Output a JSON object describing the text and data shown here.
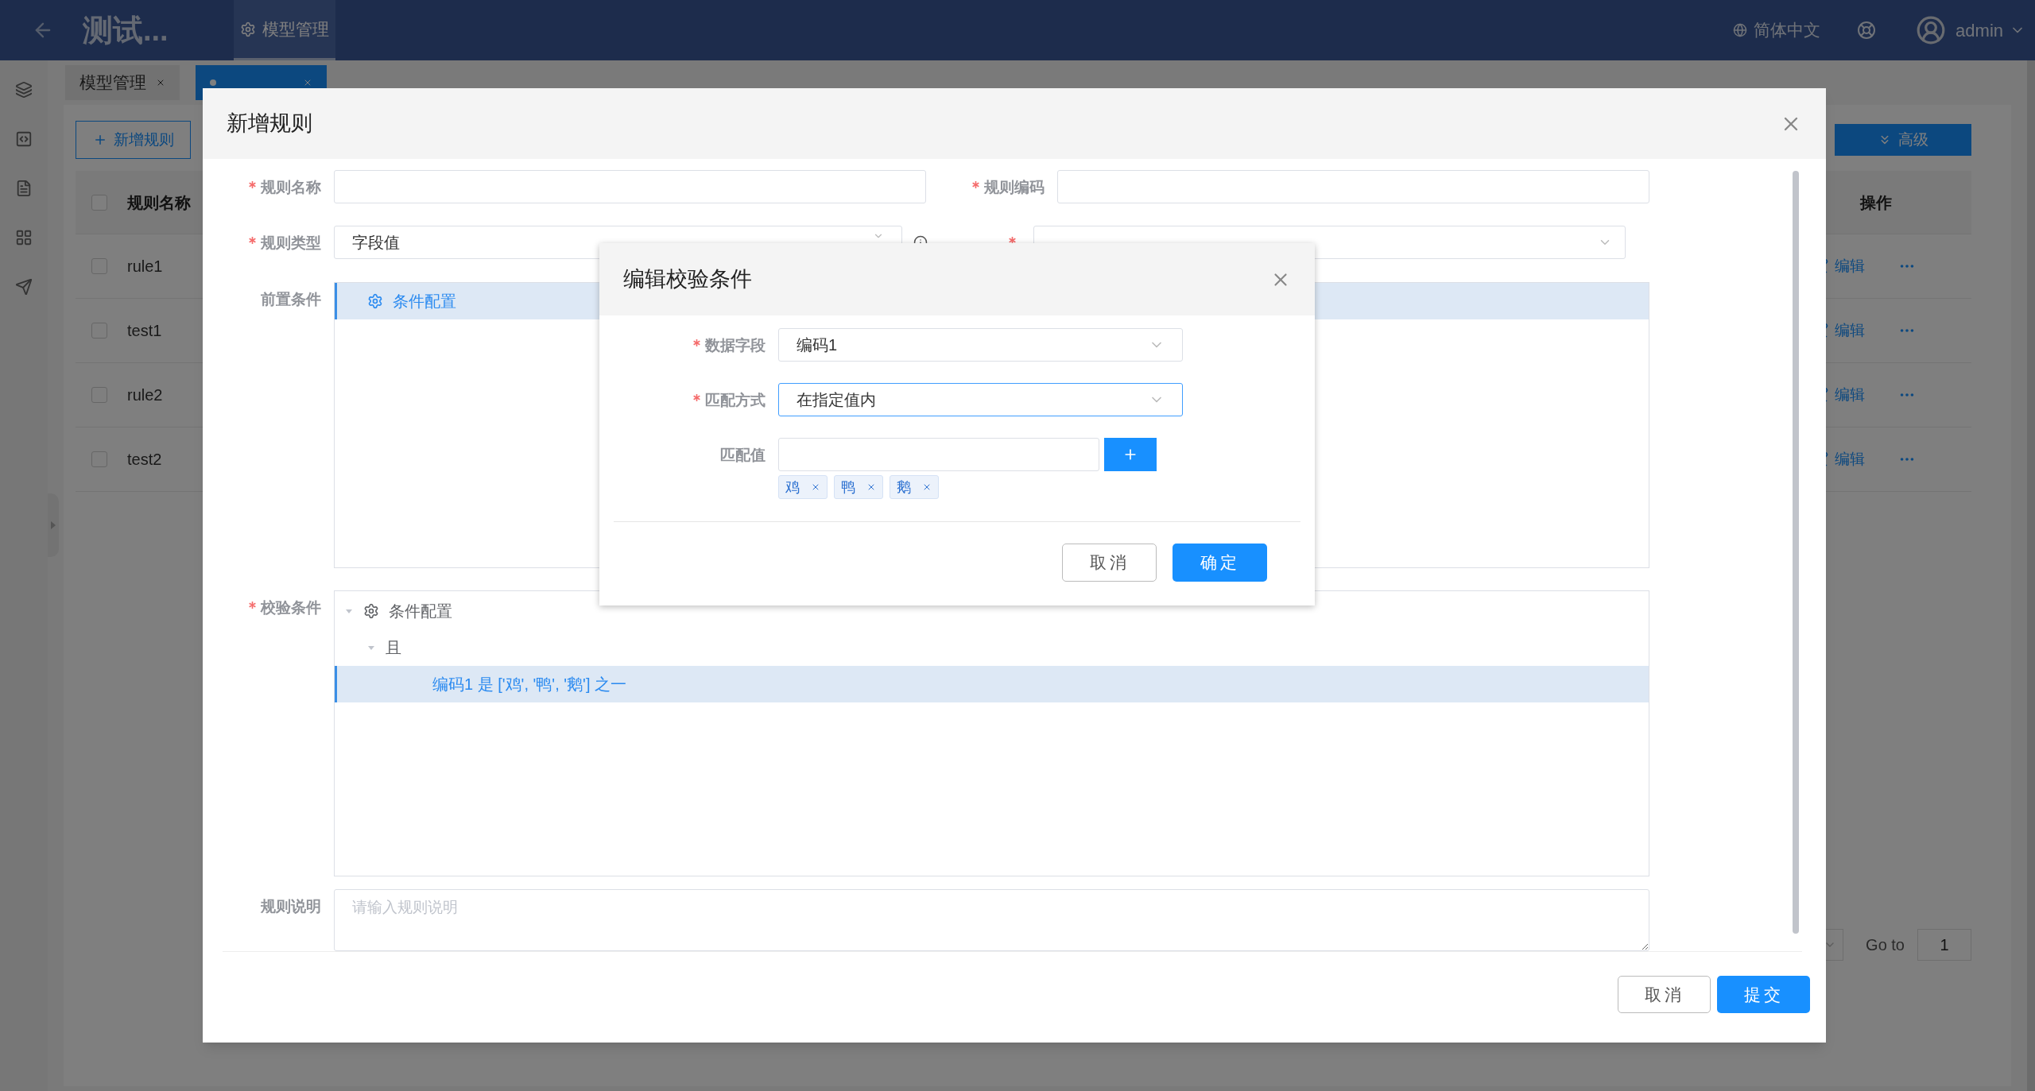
{
  "header": {
    "title": "测试...",
    "nav": [
      {
        "label": "模型管理",
        "selected": true
      }
    ],
    "language": "简体中文",
    "user": "admin"
  },
  "tabs": [
    {
      "label": "模型管理",
      "selected": false
    },
    {
      "selected": true
    }
  ],
  "toolbar": {
    "add_button": "新增规则",
    "advanced_button": "高级"
  },
  "table": {
    "columns": [
      "规则名称",
      "操作"
    ],
    "all_checked": false,
    "rows": [
      {
        "name": "rule1",
        "action": "编辑",
        "checked": false
      },
      {
        "name": "test1",
        "action": "编辑",
        "checked": false
      },
      {
        "name": "rule2",
        "action": "编辑",
        "checked": false
      },
      {
        "name": "test2",
        "action": "编辑",
        "checked": false
      }
    ]
  },
  "pagination": {
    "goto_label": "Go to",
    "page": "1"
  },
  "rule_dialog": {
    "title": "新增规则",
    "name_field": {
      "label": "规则名称",
      "required": true
    },
    "code_field": {
      "label": "规则编码",
      "required": true
    },
    "type_field": {
      "label": "规则类型",
      "required": true,
      "value": "字段值"
    },
    "enabled_field": {
      "required": true
    },
    "precondition": {
      "label": "前置条件",
      "root": "条件配置",
      "selected": true
    },
    "validation": {
      "label": "校验条件",
      "required": true,
      "tree": [
        {
          "label": "条件配置",
          "expanded": true,
          "selected": false,
          "children": [
            {
              "label": "且",
              "expanded": true,
              "selected": false,
              "children": [
                {
                  "label": "编码1 是 ['鸡', '鸭', '鹅'] 之一",
                  "selected": true
                }
              ]
            }
          ]
        }
      ]
    },
    "description": {
      "label": "规则说明",
      "placeholder": "请输入规则说明"
    },
    "buttons": [
      "取消",
      "提交"
    ]
  },
  "condition_dialog": {
    "title": "编辑校验条件",
    "field": {
      "label": "数据字段",
      "required": true,
      "value": "编码1",
      "focused": false
    },
    "match_mode": {
      "label": "匹配方式",
      "required": true,
      "value": "在指定值内",
      "focused": true
    },
    "match_value": {
      "label": "匹配值",
      "tags": [
        "鸡",
        "鸭",
        "鹅"
      ]
    },
    "buttons": [
      "取消",
      "确定"
    ]
  }
}
